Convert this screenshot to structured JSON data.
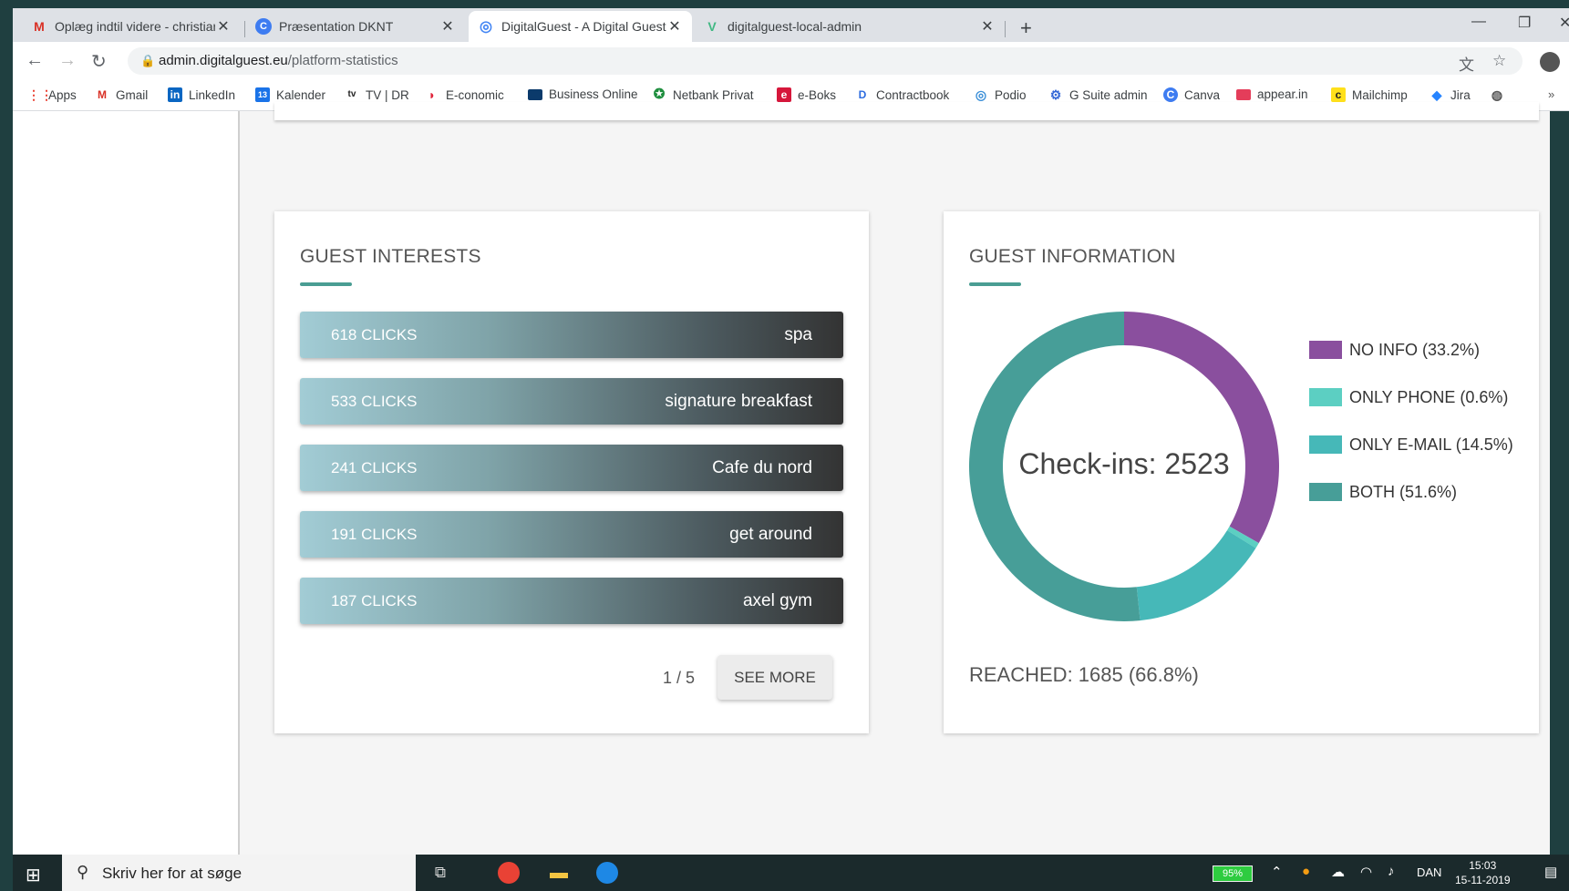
{
  "browser": {
    "tabs": [
      {
        "title": "Oplæg indtil videre - christian@d",
        "icon": "gmail-icon"
      },
      {
        "title": "Præsentation DKNT",
        "icon": "canva-icon"
      },
      {
        "title": "DigitalGuest - A Digital Guestbo",
        "icon": "digitalguest-icon",
        "active": true
      },
      {
        "title": "digitalguest-local-admin",
        "icon": "vue-icon"
      }
    ],
    "new_tab": "+",
    "url_host": "admin.digitalguest.eu",
    "url_path": "/platform-statistics",
    "bookmarks": [
      "Apps",
      "Gmail",
      "LinkedIn",
      "Kalender",
      "TV | DR",
      "E-conomic",
      "Business Online",
      "Netbank Privat",
      "e-Boks",
      "Contractbook",
      "Podio",
      "G Suite admin",
      "Canva",
      "appear.in",
      "Mailchimp",
      "Jira"
    ]
  },
  "interests": {
    "title": "GUEST INTERESTS",
    "items": [
      {
        "clicks": "618 CLICKS",
        "name": "spa"
      },
      {
        "clicks": "533 CLICKS",
        "name": "signature breakfast"
      },
      {
        "clicks": "241 CLICKS",
        "name": "Cafe du nord"
      },
      {
        "clicks": "191 CLICKS",
        "name": "get around"
      },
      {
        "clicks": "187 CLICKS",
        "name": "axel gym"
      }
    ],
    "pager": "1 / 5",
    "see_more": "SEE MORE"
  },
  "info": {
    "title": "GUEST INFORMATION",
    "center_label": "Check-ins: 2523",
    "reached": "REACHED: 1685 (66.8%)"
  },
  "chart_data": {
    "type": "pie",
    "categories": [
      "NO INFO (33.2%)",
      "ONLY PHONE (0.6%)",
      "ONLY E-MAIL (14.5%)",
      "BOTH (51.6%)"
    ],
    "values": [
      33.2,
      0.6,
      14.5,
      51.6
    ],
    "colors": [
      "#8a4f9e",
      "#5ccfc2",
      "#46b8b8",
      "#479e98"
    ],
    "title": "Check-ins: 2523",
    "legend": "right"
  },
  "taskbar": {
    "search_placeholder": "Skriv her for at søge",
    "battery": "95%",
    "language": "DAN",
    "time": "15:03",
    "date": "15-11-2019"
  }
}
